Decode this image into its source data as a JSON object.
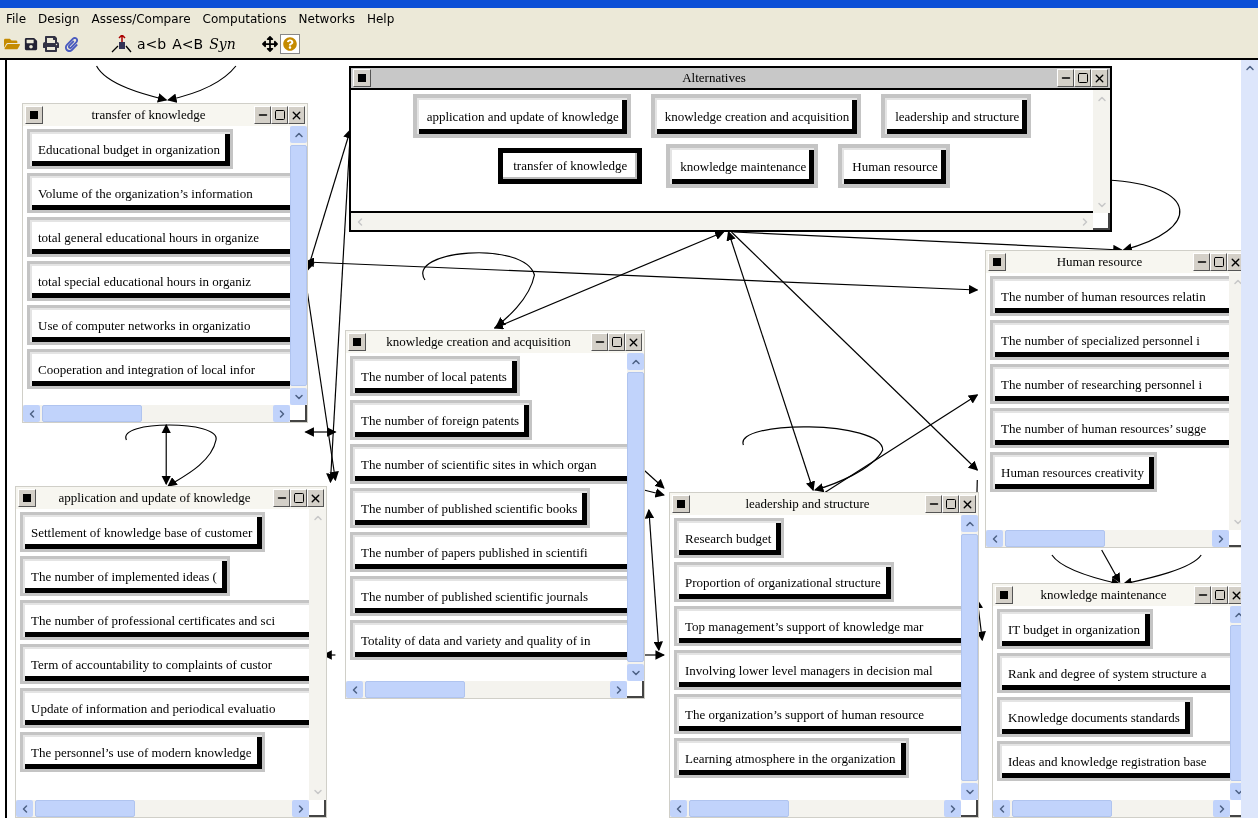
{
  "menu": [
    "File",
    "Design",
    "Assess/Compare",
    "Computations",
    "Networks",
    "Help"
  ],
  "toolbar_labels": [
    "a<b",
    "A<B",
    "Syn"
  ],
  "windows": [
    {
      "title": "Alternatives",
      "kind": "alternatives",
      "nodes": [
        {
          "label": "application and update of knowledge",
          "selected": false
        },
        {
          "label": "knowledge creation and acquisition",
          "selected": false
        },
        {
          "label": "leadership and structure",
          "selected": false
        },
        {
          "label": "transfer of knowledge",
          "selected": true
        },
        {
          "label": "knowledge maintenance",
          "selected": false
        },
        {
          "label": "Human resource",
          "selected": false
        }
      ]
    },
    {
      "title": "transfer of knowledge",
      "kind": "cluster",
      "nodes": [
        {
          "label": "Educational budget in organization",
          "cut": false
        },
        {
          "label": "Volume of the organization’s information",
          "cut": true
        },
        {
          "label": "total general educational hours in organize",
          "cut": true
        },
        {
          "label": "total special  educational hours in organiz",
          "cut": true
        },
        {
          "label": "Use of computer networks in organizatio",
          "cut": true
        },
        {
          "label": "Cooperation and integration of local infor",
          "cut": true
        }
      ]
    },
    {
      "title": "knowledge creation and acquisition",
      "kind": "cluster",
      "nodes": [
        {
          "label": "The number of local patents",
          "cut": false
        },
        {
          "label": "The number of foreign patents",
          "cut": false
        },
        {
          "label": "The number of scientific sites in which organ",
          "cut": true
        },
        {
          "label": "The number of published scientific books",
          "cut": false
        },
        {
          "label": "The number of papers published in scientifi",
          "cut": true
        },
        {
          "label": "The number of published scientific journals",
          "cut": true
        },
        {
          "label": "Totality of data and variety and quality of in",
          "cut": true
        }
      ]
    },
    {
      "title": "application and update of knowledge",
      "kind": "cluster",
      "nodes": [
        {
          "label": "Settlement of knowledge base of customer",
          "cut": false
        },
        {
          "label": "The number of implemented ideas (",
          "cut": false
        },
        {
          "label": "The number of professional certificates and sci",
          "cut": true
        },
        {
          "label": "Term of accountability to complaints of custor",
          "cut": true
        },
        {
          "label": "Update of information and periodical evaluatio",
          "cut": true
        },
        {
          "label": "The personnel’s use of modern knowledge",
          "cut": false
        }
      ]
    },
    {
      "title": "leadership and structure",
      "kind": "cluster",
      "nodes": [
        {
          "label": "Research budget",
          "cut": false
        },
        {
          "label": "Proportion of organizational structure",
          "cut": false
        },
        {
          "label": "Top management’s support of knowledge mar",
          "cut": true
        },
        {
          "label": "Involving lower level managers in decision mal",
          "cut": true
        },
        {
          "label": "The organization’s support of human resource",
          "cut": true
        },
        {
          "label": "Learning atmosphere in the organization",
          "cut": false
        }
      ]
    },
    {
      "title": "Human resource",
      "kind": "cluster",
      "nodes": [
        {
          "label": "The number of human resources relatin",
          "cut": true
        },
        {
          "label": "The number of specialized  personnel i",
          "cut": true
        },
        {
          "label": "The number of researching personnel i",
          "cut": true
        },
        {
          "label": "The number of human resources’ sugge",
          "cut": true
        },
        {
          "label": "Human resources creativity",
          "cut": false
        }
      ]
    },
    {
      "title": "knowledge maintenance",
      "kind": "cluster",
      "nodes": [
        {
          "label": "IT budget in organization",
          "cut": false
        },
        {
          "label": "Rank and degree of system structure a",
          "cut": true
        },
        {
          "label": "Knowledge documents standards",
          "cut": false
        },
        {
          "label": "Ideas and knowledge registration base",
          "cut": true
        }
      ]
    }
  ]
}
